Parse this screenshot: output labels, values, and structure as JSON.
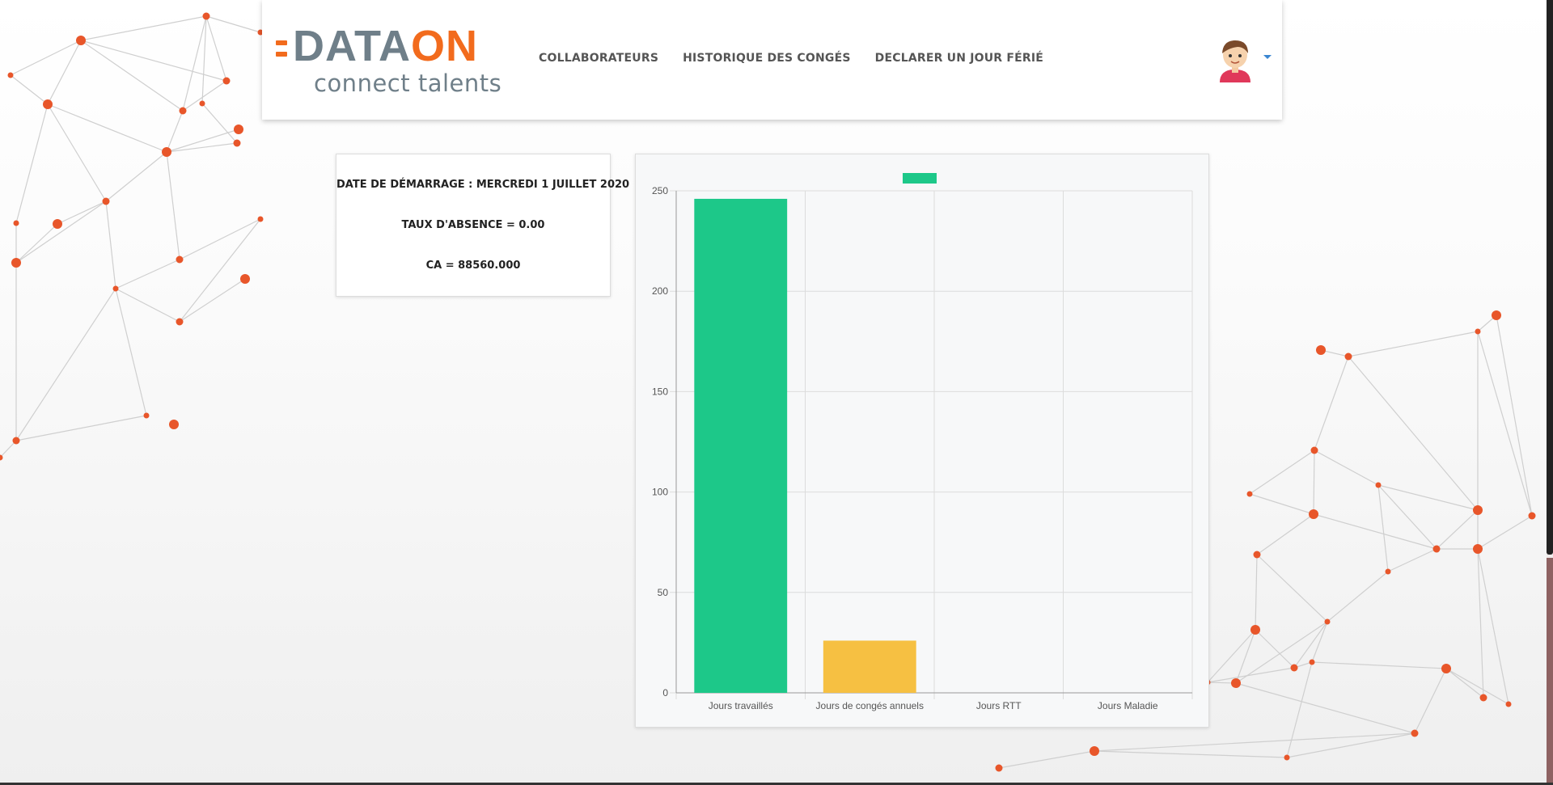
{
  "brand": {
    "logo_text_part1": "DATA",
    "logo_text_part2": "ON",
    "tagline": "connect talents",
    "primary_color": "#6f7f89",
    "accent_color": "#f26b1d"
  },
  "nav": {
    "items": [
      {
        "label": "COLLABORATEURS"
      },
      {
        "label": "HISTORIQUE DES CONGÉS"
      },
      {
        "label": "DECLARER UN JOUR FÉRIÉ"
      }
    ]
  },
  "user_menu": {
    "icon": "user-avatar-icon",
    "caret_icon": "caret-down-icon",
    "caret_color": "#3a86d1"
  },
  "info": {
    "start_date": "DATE DE DÉMARRAGE : MERCREDI 1 JUILLET 2020",
    "absence_rate": "TAUX D'ABSENCE = 0.00",
    "revenue": "CA = 88560.000"
  },
  "chart_data": {
    "type": "bar",
    "categories": [
      "Jours travaillés",
      "Jours de congés annuels",
      "Jours RTT",
      "Jours Maladie"
    ],
    "values": [
      246,
      26,
      0,
      0
    ],
    "colors": [
      "#1dc889",
      "#f6c042",
      "#e74c3c",
      "#3498db"
    ],
    "ylim": [
      0,
      250
    ],
    "yticks": [
      0,
      50,
      100,
      150,
      200,
      250
    ],
    "legend_color": "#1dc889",
    "legend_position": "top-center",
    "grid": true
  }
}
